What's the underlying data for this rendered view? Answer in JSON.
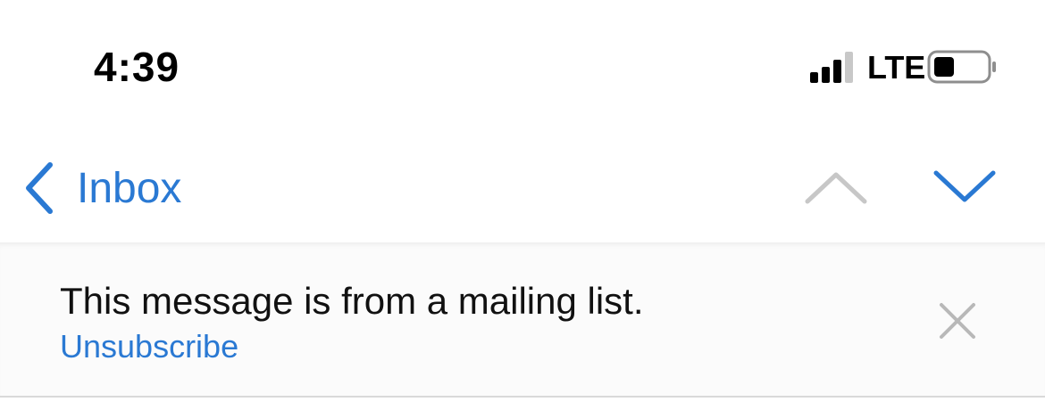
{
  "status_bar": {
    "time": "4:39",
    "network": "LTE",
    "icons": [
      "signal-icon",
      "battery-icon"
    ]
  },
  "nav": {
    "back_label": "Inbox",
    "icons": [
      "chevron-left-icon",
      "chevron-up-icon",
      "chevron-down-icon"
    ]
  },
  "banner": {
    "message": "This message is from a mailing list.",
    "unsubscribe_label": "Unsubscribe",
    "icons": [
      "close-icon"
    ]
  },
  "colors": {
    "accent": "#2a79d3",
    "disabled": "#c7c7c7",
    "banner_bg": "#fbfbfb"
  }
}
